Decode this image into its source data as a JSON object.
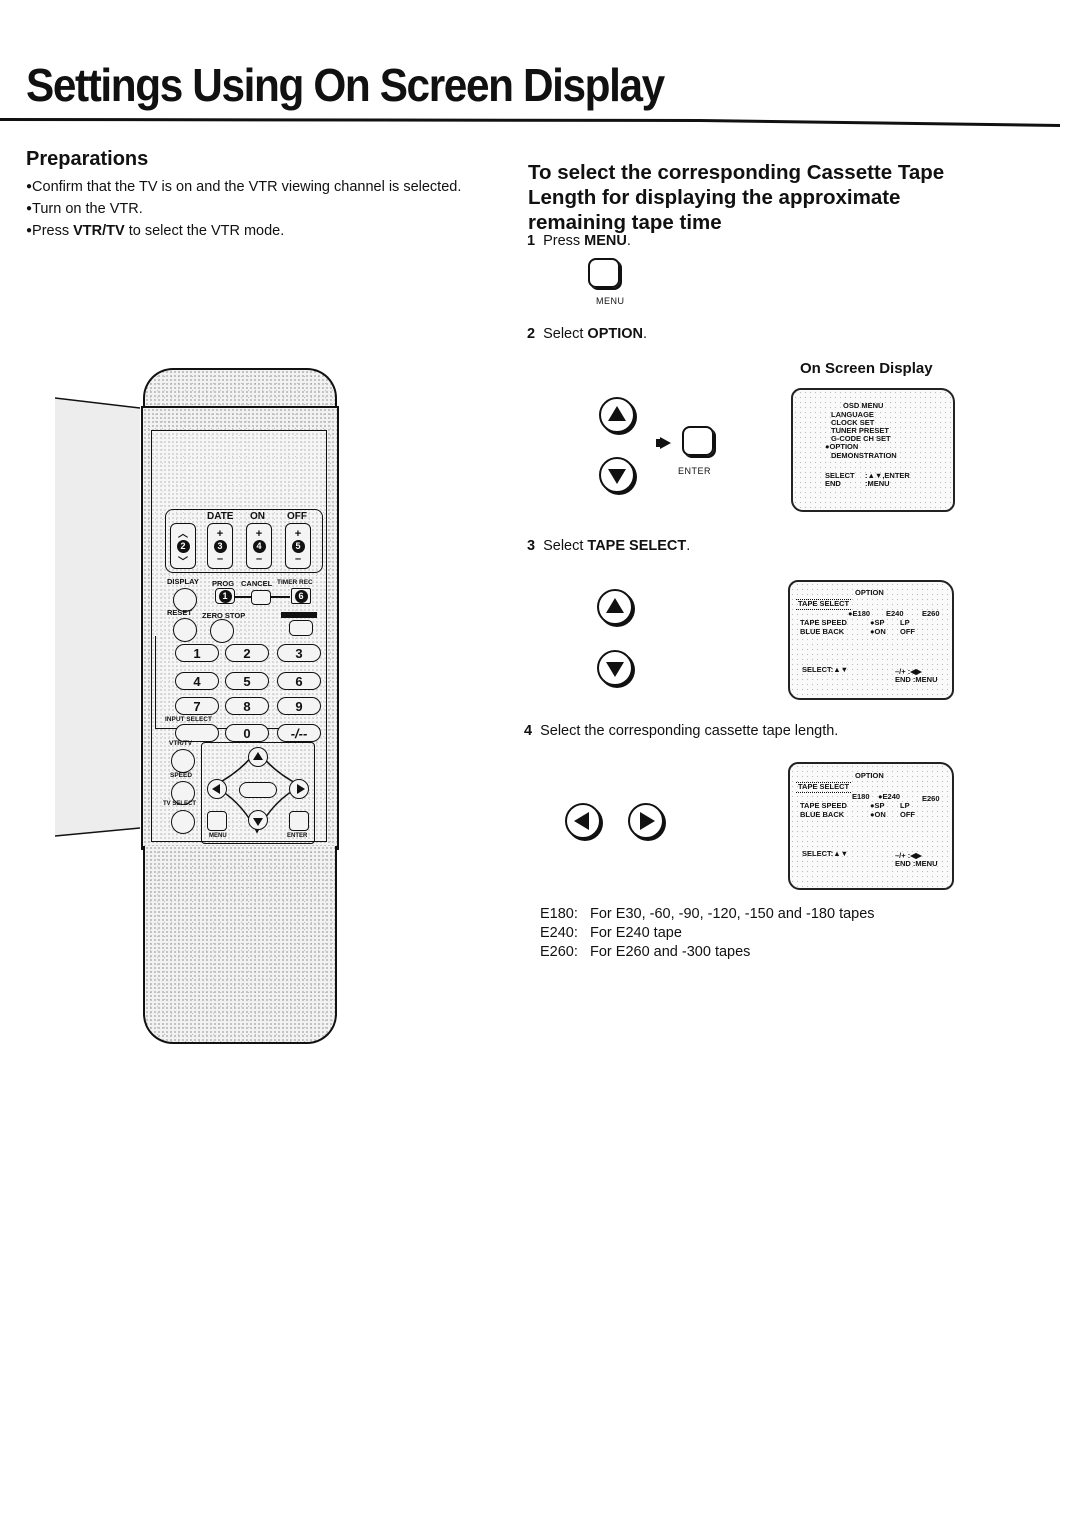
{
  "page": {
    "title": "Settings Using On Screen Display"
  },
  "preparations": {
    "heading": "Preparations",
    "items": [
      {
        "text": "Confirm that the TV is on and the VTR viewing channel is selected."
      },
      {
        "text": "Turn on the VTR."
      },
      {
        "prefix": "Press ",
        "bold": "VTR/TV",
        "suffix": " to select the VTR mode."
      }
    ]
  },
  "section": {
    "heading": "To select the corresponding Cassette Tape Length for displaying the approximate remaining tape time",
    "steps": [
      {
        "num": "1",
        "prefix": "Press ",
        "bold": "MENU",
        "suffix": "."
      },
      {
        "num": "2",
        "prefix": "Select ",
        "bold": "OPTION",
        "suffix": "."
      },
      {
        "num": "3",
        "prefix": "Select ",
        "bold": "TAPE SELECT",
        "suffix": "."
      },
      {
        "num": "4",
        "prefix": "Select the corresponding cassette tape length.",
        "bold": "",
        "suffix": ""
      }
    ],
    "menu_key_caption": "MENU",
    "enter_key_caption": "ENTER",
    "osd_label": "On Screen Display"
  },
  "osd_main": {
    "title": "OSD MENU",
    "items": [
      "LANGUAGE",
      "CLOCK SET",
      "TUNER PRESET",
      "G-CODE CH SET",
      "OPTION",
      "DEMONSTRATION"
    ],
    "selected_item": "OPTION",
    "select_hint": "SELECT",
    "select_value": ":▲▼,ENTER",
    "end_hint": "END",
    "end_value": ":MENU"
  },
  "osd_option_step3": {
    "title": "OPTION",
    "tape_select_label": "TAPE SELECT",
    "tape_options": [
      "E180",
      "E240",
      "E260"
    ],
    "tape_selected": "E180",
    "tape_speed_label": "TAPE SPEED",
    "tape_speed_options": [
      "SP",
      "LP"
    ],
    "tape_speed_selected": "SP",
    "blue_back_label": "BLUE BACK",
    "blue_back_options": [
      "ON",
      "OFF"
    ],
    "blue_back_selected": "ON",
    "select_hint": "SELECT:▲▼",
    "adjust_hint": "–/+ :◀▶",
    "end_hint": "END :MENU"
  },
  "osd_option_step4": {
    "title": "OPTION",
    "tape_select_label": "TAPE SELECT",
    "tape_options": [
      "E180",
      "E240",
      "E260"
    ],
    "tape_selected": "E240",
    "tape_speed_label": "TAPE SPEED",
    "tape_speed_options": [
      "SP",
      "LP"
    ],
    "tape_speed_selected": "SP",
    "blue_back_label": "BLUE BACK",
    "blue_back_options": [
      "ON",
      "OFF"
    ],
    "blue_back_selected": "ON",
    "select_hint": "SELECT:▲▼",
    "adjust_hint": "–/+ :◀▶",
    "end_hint": "END :MENU"
  },
  "tape_notes": [
    {
      "code": "E180:",
      "desc": "For E30, -60, -90, -120, -150 and -180 tapes"
    },
    {
      "code": "E240:",
      "desc": "For E240 tape"
    },
    {
      "code": "E260:",
      "desc": "For E260 and -300 tapes"
    }
  ],
  "remote": {
    "labels": {
      "date": "DATE",
      "on": "ON",
      "off": "OFF",
      "display": "DISPLAY",
      "prog": "PROG",
      "cancel": "CANCEL",
      "timer_rec": "TIMER REC",
      "reset": "RESET",
      "zero_stop": "ZERO STOP",
      "input_select": "INPUT SELECT",
      "vtr_tv": "VTR/TV",
      "speed": "SPEED",
      "tv_select": "TV SELECT",
      "menu": "MENU",
      "enter": "ENTER"
    },
    "circled_numbers": [
      "2",
      "3",
      "4",
      "5",
      "1",
      "6"
    ],
    "number_keys": [
      "1",
      "2",
      "3",
      "4",
      "5",
      "6",
      "7",
      "8",
      "9",
      "0",
      "-/--"
    ]
  }
}
